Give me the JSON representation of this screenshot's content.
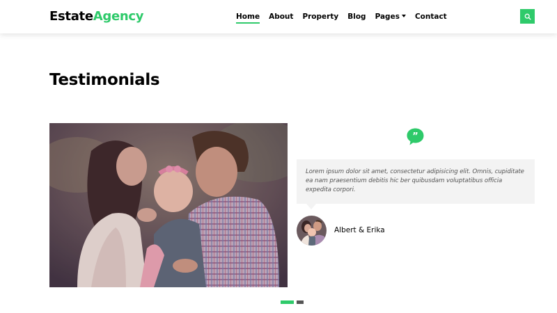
{
  "brand": {
    "part1": "Estate",
    "part2": "Agency"
  },
  "nav": {
    "items": [
      {
        "label": "Home"
      },
      {
        "label": "About"
      },
      {
        "label": "Property"
      },
      {
        "label": "Blog"
      },
      {
        "label": "Pages"
      },
      {
        "label": "Contact"
      }
    ],
    "active_index": 0,
    "dropdown_index": 4,
    "search_icon": "search-icon"
  },
  "section": {
    "title": "Testimonials"
  },
  "testimonial": {
    "quote_icon": "quote-icon",
    "text": "Lorem ipsum dolor sit amet, consectetur adipisicing elit. Omnis, cupiditate ea nam praesentium debitis hic ber quibusdam voluptatibus officia expedita corpori.",
    "author": "Albert & Erika"
  },
  "carousel": {
    "slides": 2,
    "active": 0
  },
  "colors": {
    "accent": "#2eca6a",
    "text": "#000000",
    "muted": "#555555",
    "box_bg": "#f3f3f3"
  }
}
